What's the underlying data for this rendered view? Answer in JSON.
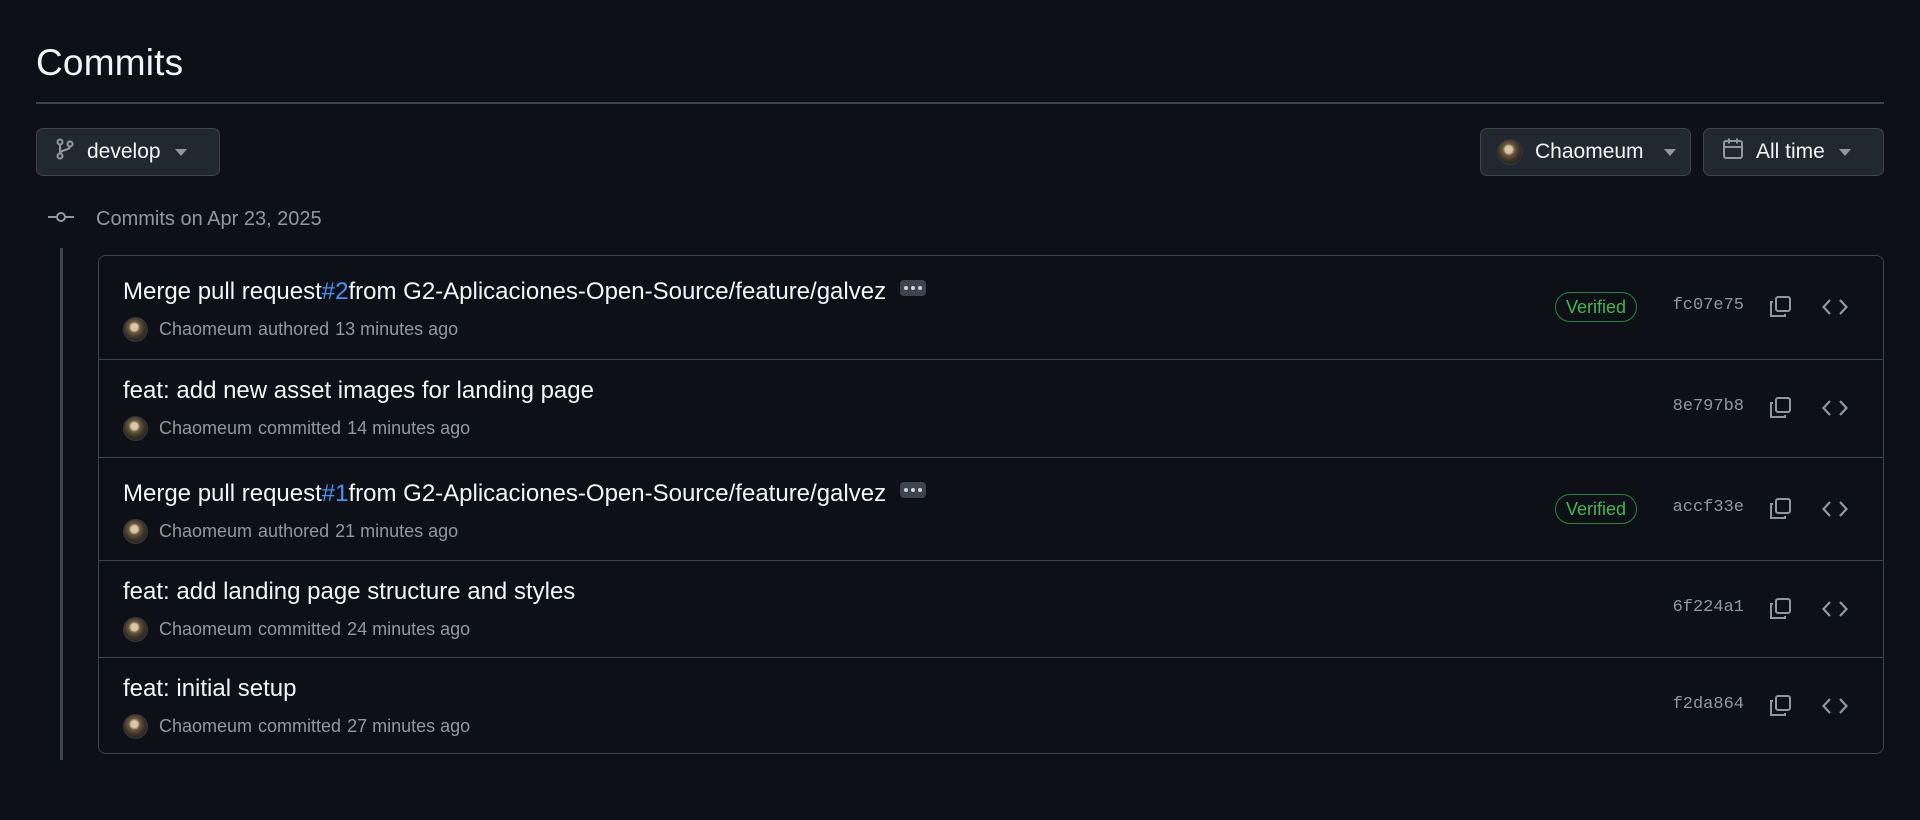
{
  "page": {
    "title": "Commits"
  },
  "filters": {
    "branch": {
      "label": "develop",
      "icon": "git-branch-icon"
    },
    "author": {
      "label": "Chaomeum",
      "icon": "avatar"
    },
    "time": {
      "label": "All time",
      "icon": "calendar-icon"
    }
  },
  "timeline": {
    "date_label": "Commits on Apr 23, 2025"
  },
  "commits": [
    {
      "title_prefix": "Merge pull request ",
      "pr": "#2",
      "title_suffix": " from G2-Aplicaciones-Open-Source/feature/galvez",
      "has_ellipsis": true,
      "author": "Chaomeum",
      "verb": "authored",
      "time": "13 minutes ago",
      "verified": "Verified",
      "sha": "fc07e75"
    },
    {
      "title_prefix": "feat: add new asset images for landing page",
      "pr": "",
      "title_suffix": "",
      "has_ellipsis": false,
      "author": "Chaomeum",
      "verb": "committed",
      "time": "14 minutes ago",
      "verified": "",
      "sha": "8e797b8"
    },
    {
      "title_prefix": "Merge pull request ",
      "pr": "#1",
      "title_suffix": " from G2-Aplicaciones-Open-Source/feature/galvez",
      "has_ellipsis": true,
      "author": "Chaomeum",
      "verb": "authored",
      "time": "21 minutes ago",
      "verified": "Verified",
      "sha": "accf33e"
    },
    {
      "title_prefix": "feat: add landing page structure and styles",
      "pr": "",
      "title_suffix": "",
      "has_ellipsis": false,
      "author": "Chaomeum",
      "verb": "committed",
      "time": "24 minutes ago",
      "verified": "",
      "sha": "6f224a1"
    },
    {
      "title_prefix": "feat: initial setup",
      "pr": "",
      "title_suffix": "",
      "has_ellipsis": false,
      "author": "Chaomeum",
      "verb": "committed",
      "time": "27 minutes ago",
      "verified": "",
      "sha": "f2da864"
    }
  ],
  "colors": {
    "background": "#0d1117",
    "border": "#3d444d",
    "link": "#4493f8",
    "verified": "#3fb950",
    "muted": "#9198a1"
  }
}
